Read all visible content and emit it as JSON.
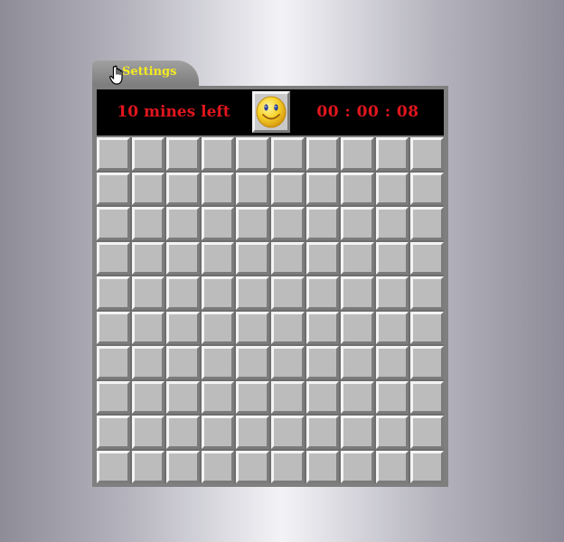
{
  "settings_tab": {
    "label": "Settings",
    "cursor_icon": "hand-pointer-icon"
  },
  "header": {
    "mines_left_text": "10 mines left",
    "timer_text": "00 : 00 : 08",
    "face_icon": "smiley-face-icon"
  },
  "board": {
    "rows": 10,
    "columns": 10,
    "cell_state": "covered"
  },
  "colors": {
    "counter_text": "#e0161d",
    "settings_text": "#f5ea21",
    "header_background": "#000000",
    "cell_face": "#bcbcbc"
  }
}
